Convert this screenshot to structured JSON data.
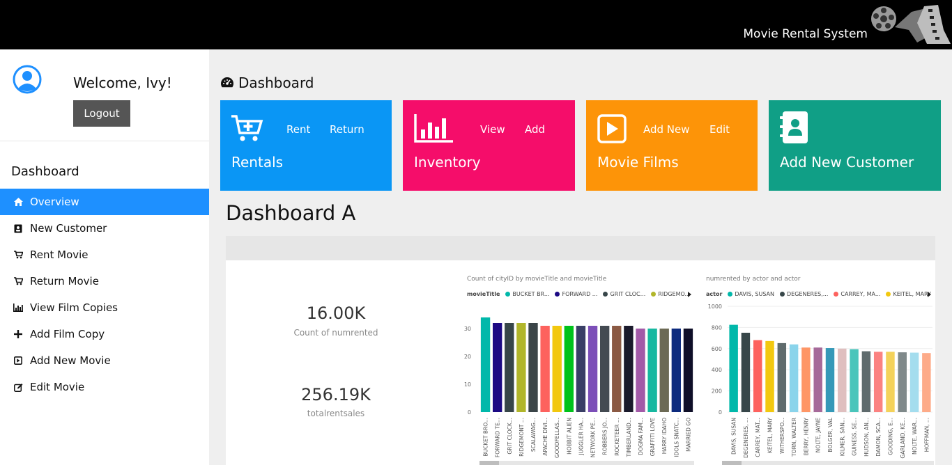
{
  "header": {
    "brand": "Movie Rental System"
  },
  "sidebar": {
    "welcome": "Welcome, Ivy!",
    "logout": "Logout",
    "heading": "Dashboard",
    "items": [
      {
        "label": "Overview",
        "icon": "home-icon",
        "active": true
      },
      {
        "label": "New Customer",
        "icon": "contact-card-icon"
      },
      {
        "label": "Rent Movie",
        "icon": "cart-icon"
      },
      {
        "label": "Return Movie",
        "icon": "cart-icon"
      },
      {
        "label": "View Film Copies",
        "icon": "bar-chart-icon"
      },
      {
        "label": "Add Film Copy",
        "icon": "plus-icon"
      },
      {
        "label": "Add New Movie",
        "icon": "play-square-icon"
      },
      {
        "label": "Edit Movie",
        "icon": "edit-icon"
      }
    ]
  },
  "main": {
    "title": "Dashboard",
    "subtitle": "Dashboard A"
  },
  "tiles": [
    {
      "title": "Rentals",
      "color": "#0a96f5",
      "links": [
        "Rent",
        "Return"
      ],
      "icon": "cart-plus-icon"
    },
    {
      "title": "Inventory",
      "color": "#f50d6a",
      "links": [
        "View",
        "Add"
      ],
      "icon": "bar-chart-icon"
    },
    {
      "title": "Movie Films",
      "color": "#fd9408",
      "links": [
        "Add New",
        "Edit"
      ],
      "icon": "play-square-icon"
    },
    {
      "title": "Add New Customer",
      "color": "#109f86",
      "links": [],
      "icon": "contact-book-icon"
    }
  ],
  "kpis": [
    {
      "value": "16.00K",
      "label": "Count of numrented"
    },
    {
      "value": "256.19K",
      "label": "totalrentsales"
    }
  ],
  "chart_data": [
    {
      "type": "bar",
      "title": "Count of cityID by movieTitle and movieTitle",
      "legend_title": "movieTitle",
      "legend": [
        "BUCKET BR...",
        "FORWARD ...",
        "GRIT CLOC...",
        "RIDGEMO..."
      ],
      "categories": [
        "BUCKET BRO...",
        "FORWARD TE...",
        "GRIT CLOCK...",
        "RIDGEMONT ...",
        "SCALAWAG...",
        "APACHE DIVI...",
        "GOODFELLAS...",
        "HOBBIT ALIEN",
        "JUGGLER HA...",
        "NETWORK PE...",
        "ROBBERS JO...",
        "ROCKETEER ...",
        "TIMBERLAND...",
        "DOGMA FAM...",
        "GRAFFITI LOVE",
        "HARRY IDAHO",
        "IDOLS SNATC...",
        "MARRIED GO"
      ],
      "values": [
        34,
        32,
        32,
        32,
        32,
        31,
        31,
        31,
        31,
        31,
        31,
        31,
        31,
        30,
        30,
        30,
        30,
        30
      ],
      "colors": [
        "#01b8aa",
        "#1c0a84",
        "#374649",
        "#b1b62b",
        "#3b4548",
        "#fd625e",
        "#f2c80f",
        "#00c21a",
        "#3a3f66",
        "#7c4fb8",
        "#444a52",
        "#8b5a44",
        "#1a1a2b",
        "#a35aa8",
        "#17b8a0",
        "#6c6a55",
        "#0d2b7e",
        "#0f0f28"
      ],
      "yticks": [
        0,
        10,
        20,
        30
      ],
      "ylim": [
        0,
        36
      ]
    },
    {
      "type": "bar",
      "title": "numrented by actor and actor",
      "legend_title": "actor",
      "legend": [
        "DAVIS, SUSAN",
        "DEGENERES,...",
        "CARREY, MA...",
        "KEITEL, MARY"
      ],
      "categories": [
        "DAVIS, SUSAN",
        "DEGENERES, ...",
        "CARREY, MAT...",
        "KEITEL, MARY",
        "WITHERSPO...",
        "TORN, WALTER",
        "BERRY, HENRY",
        "NOLTE, JAYNE",
        "BOLGER, VAL",
        "KILMER, SAN...",
        "GUINESS, SE...",
        "HUDSON, AN...",
        "DAMON, SCA...",
        "GOODING, E...",
        "GARLAND, KE...",
        "NOLTE, WAR...",
        "HOFFMAN, ..."
      ],
      "values": [
        825,
        750,
        680,
        672,
        652,
        640,
        610,
        610,
        605,
        600,
        595,
        575,
        570,
        570,
        565,
        562,
        558
      ],
      "colors": [
        "#01b8aa",
        "#374649",
        "#fd625e",
        "#f2c80f",
        "#5f6b6d",
        "#8ad4eb",
        "#fe9666",
        "#a66999",
        "#3599b8",
        "#dfbfbf",
        "#4ac5bb",
        "#5f6b6d",
        "#fb8281",
        "#f4d25a",
        "#7f898a",
        "#a4ddee",
        "#fdab89"
      ],
      "yticks": [
        0,
        200,
        400,
        600,
        800,
        1000
      ],
      "ylim": [
        0,
        1000
      ]
    }
  ]
}
